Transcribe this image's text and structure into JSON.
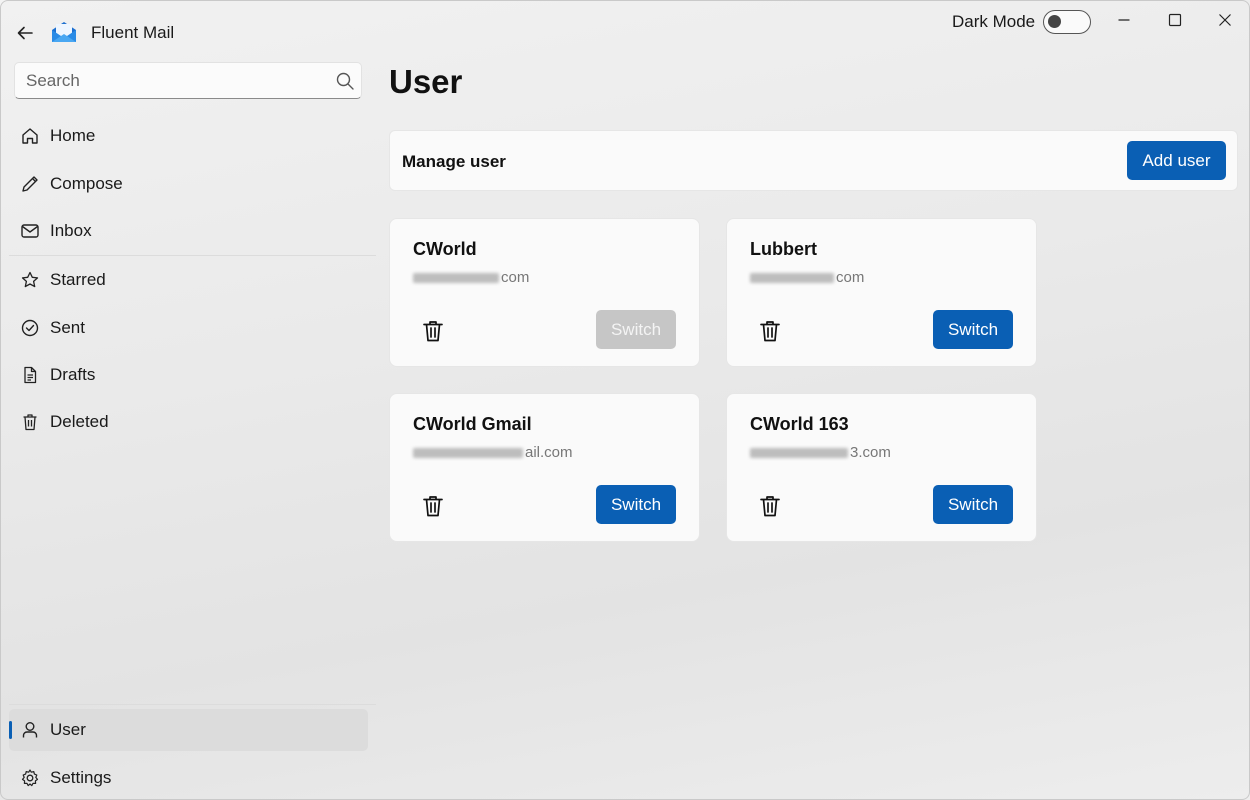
{
  "app": {
    "title": "Fluent Mail"
  },
  "titlebar": {
    "dark_mode_label": "Dark Mode",
    "dark_mode_on": false
  },
  "search": {
    "placeholder": "Search",
    "value": ""
  },
  "sidebar": {
    "items": [
      {
        "label": "Home",
        "icon": "home-icon"
      },
      {
        "label": "Compose",
        "icon": "pencil-icon"
      },
      {
        "label": "Inbox",
        "icon": "envelope-icon"
      },
      {
        "label": "Starred",
        "icon": "star-icon"
      },
      {
        "label": "Sent",
        "icon": "check-circle-icon"
      },
      {
        "label": "Drafts",
        "icon": "document-icon"
      },
      {
        "label": "Deleted",
        "icon": "trash-icon"
      }
    ],
    "footer": [
      {
        "label": "User",
        "icon": "person-icon",
        "active": true
      },
      {
        "label": "Settings",
        "icon": "gear-icon"
      }
    ]
  },
  "main": {
    "title": "User",
    "manage_label": "Manage user",
    "add_user_label": "Add user",
    "users": [
      {
        "name": "CWorld",
        "email_suffix": "com",
        "switch_label": "Switch",
        "switch_enabled": false
      },
      {
        "name": "Lubbert",
        "email_suffix": "com",
        "switch_label": "Switch",
        "switch_enabled": true
      },
      {
        "name": "CWorld Gmail",
        "email_suffix": "ail.com",
        "switch_label": "Switch",
        "switch_enabled": true
      },
      {
        "name": "CWorld 163",
        "email_suffix": "3.com",
        "switch_label": "Switch",
        "switch_enabled": true
      }
    ]
  },
  "colors": {
    "accent": "#0a5fb4",
    "disabled_button": "#c6c6c6"
  }
}
